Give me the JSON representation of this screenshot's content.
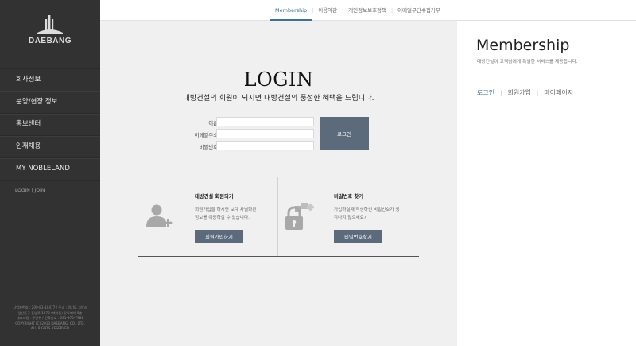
{
  "brand": {
    "name": "DAEBANG"
  },
  "sidebar": {
    "items": [
      {
        "label": "회사정보"
      },
      {
        "label": "분양/현장 정보"
      },
      {
        "label": "홍보센터"
      },
      {
        "label": "인재채용"
      },
      {
        "label": "MY NOBLELAND"
      }
    ],
    "login_label": "LOGIN",
    "auth_sep": "|",
    "join_label": "JOIN",
    "footer": [
      "사업자번호 : 209-81-10477 / 주소 : 경기도 고양시",
      "일산동구 중앙로 1072 (백석동) 유토피아 5층",
      "대표자명 : 구찬우 / 전화번호 : 031-975-7988",
      "COPYRIGHT (C) 2013 DAEBANG. CO., LTD.",
      "ALL RIGHTS RESERVED"
    ]
  },
  "topnav": {
    "items": [
      {
        "label": "Membership"
      },
      {
        "label": "이용약관"
      },
      {
        "label": "개인정보보호정책"
      },
      {
        "label": "이메일무단수집거부"
      }
    ],
    "separator": "|"
  },
  "login": {
    "title": "LOGIN",
    "subtitle": "대방건설의 회원이 되시면 대방건설의 풍성한 혜택을 드립니다.",
    "name_label": "이름",
    "email_label": "이메일주소",
    "password_label": "비밀번호",
    "name_value": "",
    "email_value": "",
    "password_value": "",
    "button_label": "로그인"
  },
  "signup_panel": {
    "title": "대방건설 회원되기",
    "desc_line1": "회원가입을 하시면 보다 차별화된",
    "desc_line2": "정보를 이용하실 수 있습니다.",
    "button_label": "회원가입하기"
  },
  "password_panel": {
    "title": "비밀번호 찾기",
    "desc_line1": "가입하실때 작성하신 비밀번호가 생",
    "desc_line2": "각나지 않으세요?",
    "button_label": "비밀번호찾기"
  },
  "right_panel": {
    "title": "Membership",
    "desc": "대방건설이 고객님에게 특별한 서비스를 제공합니다.",
    "links": [
      {
        "label": "로그인"
      },
      {
        "label": "회원가입"
      },
      {
        "label": "마이페이지"
      }
    ],
    "separator": "|"
  },
  "colors": {
    "sidebar_bg": "#323232",
    "accent": "#3d6f9a",
    "button": "#5b6b7c",
    "main_bg": "#f0f0f0"
  }
}
